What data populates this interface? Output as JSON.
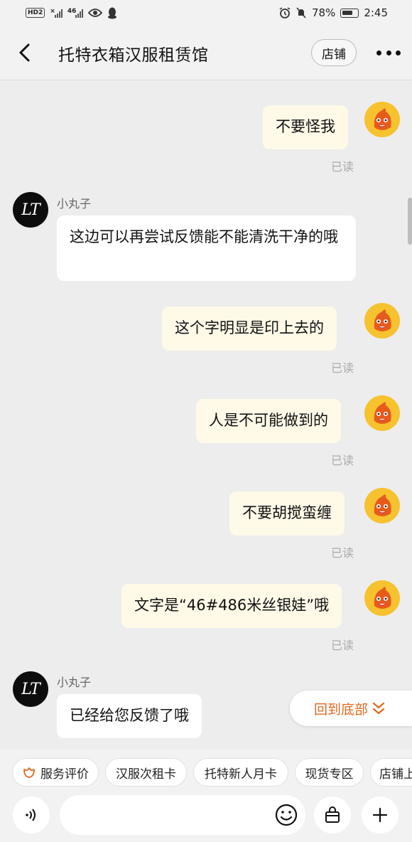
{
  "status_bar": {
    "hd_badge": "HD",
    "hd_sub": "2",
    "net_label": "46",
    "battery": "78%",
    "time": "2:45"
  },
  "header": {
    "title": "托特衣箱汉服租赁馆",
    "shop_label": "店铺"
  },
  "messages": [
    {
      "side": "me",
      "text": "不要怪我",
      "read_label": "已读"
    },
    {
      "side": "them",
      "sender": "小丸子",
      "text": "这边可以再尝试反馈能不能清洗干净的哦"
    },
    {
      "side": "me",
      "text": "这个字明显是印上去的",
      "read_label": "已读"
    },
    {
      "side": "me",
      "text": "人是不可能做到的",
      "read_label": "已读"
    },
    {
      "side": "me",
      "text": "不要胡搅蛮缠",
      "read_label": "已读"
    },
    {
      "side": "me",
      "text": "文字是“46#486米丝银娃”哦",
      "read_label": "已读"
    },
    {
      "side": "them",
      "sender": "小丸子",
      "text": "已经给您反馈了哦"
    }
  ],
  "avatar_them_text": "LT",
  "jump_to_bottom": "回到底部",
  "quick_actions": [
    "服务评价",
    "汉服次租卡",
    "托特新人月卡",
    "现货专区",
    "店铺上新"
  ],
  "input": {
    "placeholder": ""
  },
  "colors": {
    "accent": "#e0691e",
    "my_bubble": "#fff9e8",
    "background": "#ededed"
  },
  "icons": [
    "back-arrow-icon",
    "more-dots-icon",
    "voice-icon",
    "emoji-icon",
    "shopping-bag-icon",
    "plus-icon",
    "chevron-double-down-icon",
    "flower-icon"
  ]
}
